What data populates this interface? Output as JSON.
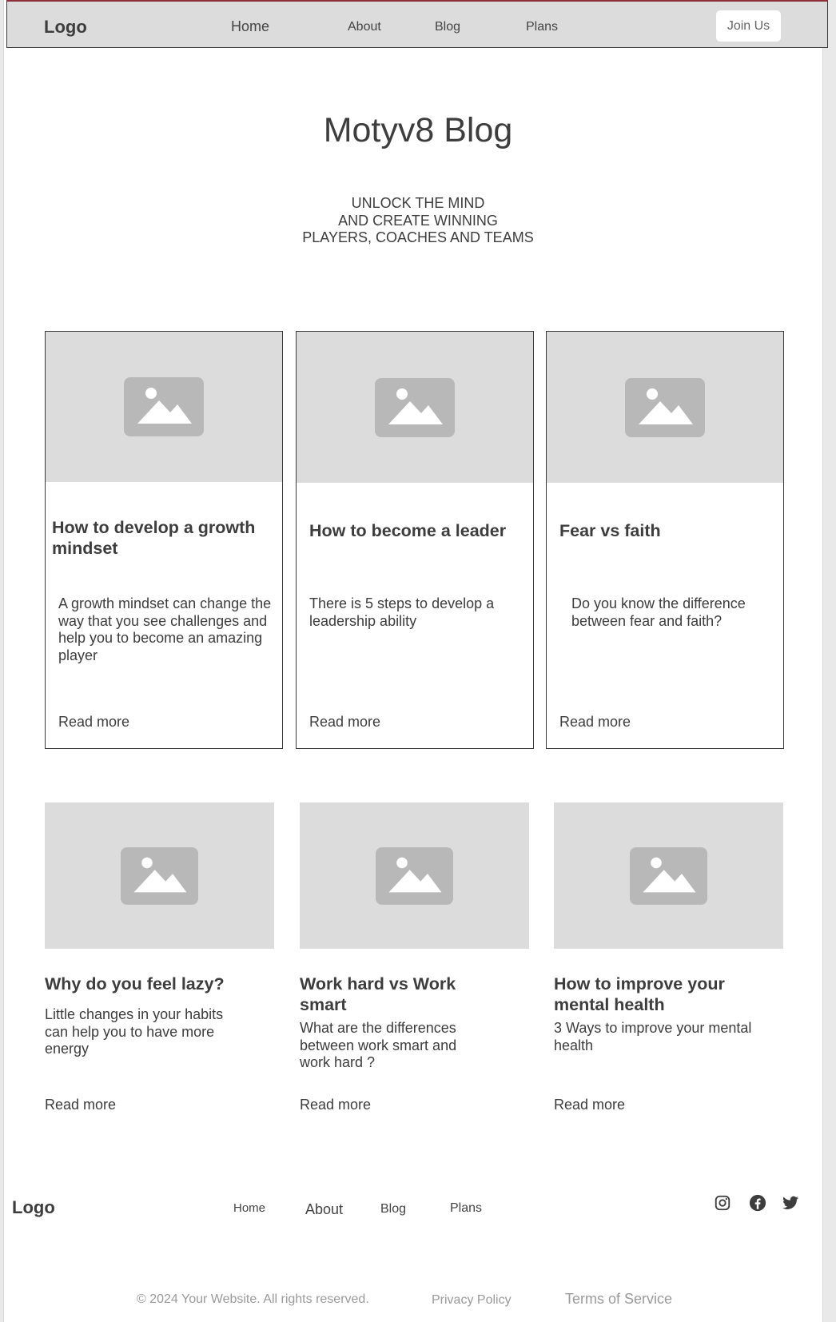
{
  "nav": {
    "logo": "Logo",
    "links": [
      "Home",
      "About",
      "Blog",
      "Plans"
    ],
    "cta": "Join Us"
  },
  "hero": {
    "title": "Motyv8 Blog",
    "subtitle_lines": [
      "UNLOCK THE MIND",
      "AND CREATE WINNING",
      "PLAYERS, COACHES AND TEAMS"
    ]
  },
  "posts_row1": [
    {
      "title": "How to develop a growth mindset",
      "desc": "A growth mindset can change the way that you see challenges and help you to become an amazing player",
      "link": "Read more"
    },
    {
      "title": "How to become a leader",
      "desc": "There is 5 steps to develop a leadership ability",
      "link": "Read more"
    },
    {
      "title": "Fear vs faith",
      "desc": "Do you know the difference between fear and faith?",
      "link": "Read more"
    }
  ],
  "posts_row2": [
    {
      "title": "Why do you feel lazy?",
      "desc": "Little changes in your habits can help you to have more energy",
      "link": "Read more"
    },
    {
      "title": "Work hard vs Work smart",
      "desc": "What are the differences between work smart and work hard ?",
      "link": "Read more"
    },
    {
      "title": "How to improve your mental health",
      "desc": "3 Ways to improve your mental health",
      "link": "Read more"
    }
  ],
  "footer": {
    "logo": "Logo",
    "links": [
      "Home",
      "About",
      "Blog",
      "Plans"
    ],
    "social_icons": [
      "instagram-icon",
      "facebook-icon",
      "twitter-icon"
    ],
    "copyright": "© 2024 Your Website. All rights reserved.",
    "privacy": "Privacy Policy",
    "terms": "Terms of Service"
  },
  "colors": {
    "placeholder_bg": "#dcdcdc",
    "placeholder_icon": "#b8b8b8",
    "text": "#3d3d3d",
    "nav_border_accent": "#8c2f39"
  }
}
